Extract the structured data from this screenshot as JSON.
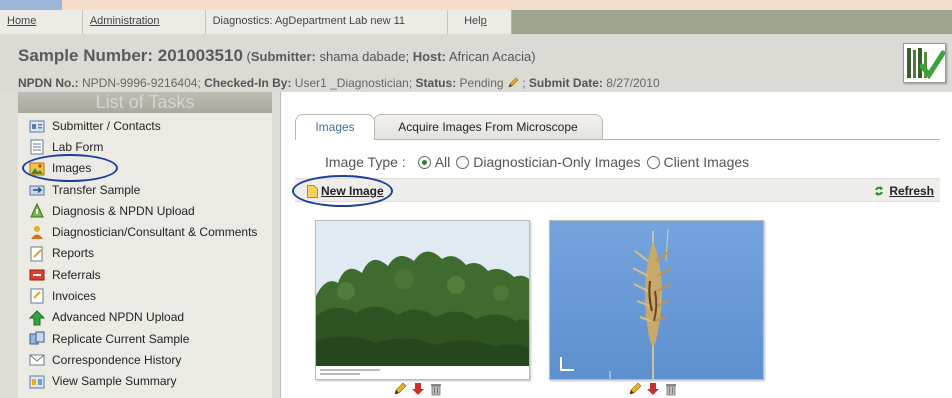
{
  "menu": {
    "home": "Home",
    "admin": "Administration",
    "diagnostics": "Diagnostics: AgDepartment Lab new 11",
    "help_pre": "Hel",
    "help_u": "p"
  },
  "header": {
    "sample_label": "Sample Number: 201003510",
    "paren_open": " (",
    "submitter_key": "Submitter:",
    "submitter_value": " shama dabade; ",
    "host_key": "Host:",
    "host_value": " African Acacia)",
    "npdn_key": "NPDN No.:",
    "npdn_value": " NPDN-9996-9216404; ",
    "checked_key": "Checked-In By:",
    "checked_value": " User1 _Diagnostician; ",
    "status_key": "Status:",
    "status_value": " Pending ",
    "sep": " ; ",
    "submit_key": "Submit Date:",
    "submit_value": " 8/27/2010"
  },
  "tasks": {
    "title": "List of Tasks",
    "items": [
      {
        "label": "Submitter / Contacts",
        "icon": "contacts-icon"
      },
      {
        "label": "Lab Form",
        "icon": "form-icon"
      },
      {
        "label": "Images",
        "icon": "images-icon"
      },
      {
        "label": "Transfer Sample",
        "icon": "transfer-icon"
      },
      {
        "label": "Diagnosis & NPDN Upload",
        "icon": "diagnosis-icon"
      },
      {
        "label": "Diagnostician/Consultant & Comments",
        "icon": "person-icon"
      },
      {
        "label": "Reports",
        "icon": "reports-icon"
      },
      {
        "label": "Referrals",
        "icon": "referrals-icon"
      },
      {
        "label": "Invoices",
        "icon": "invoices-icon"
      },
      {
        "label": "Advanced NPDN Upload",
        "icon": "upload-arrow-icon"
      },
      {
        "label": "Replicate Current Sample",
        "icon": "replicate-icon"
      },
      {
        "label": "Correspondence History",
        "icon": "mail-icon"
      },
      {
        "label": "View Sample Summary",
        "icon": "summary-icon"
      }
    ]
  },
  "tabs": {
    "images": "Images",
    "acquire": "Acquire Images From Microscope"
  },
  "image_type": {
    "label": "Image Type :",
    "options": [
      "All",
      "Diagnostician-Only Images",
      "Client Images"
    ],
    "selected": "All"
  },
  "toolbar": {
    "new_image": "New Image",
    "refresh": "Refresh"
  },
  "colors": {
    "highlight_circle": "#1c3d9a",
    "tab_active_text": "#3f6f9f",
    "radio_selected": "#2a8a2a"
  }
}
